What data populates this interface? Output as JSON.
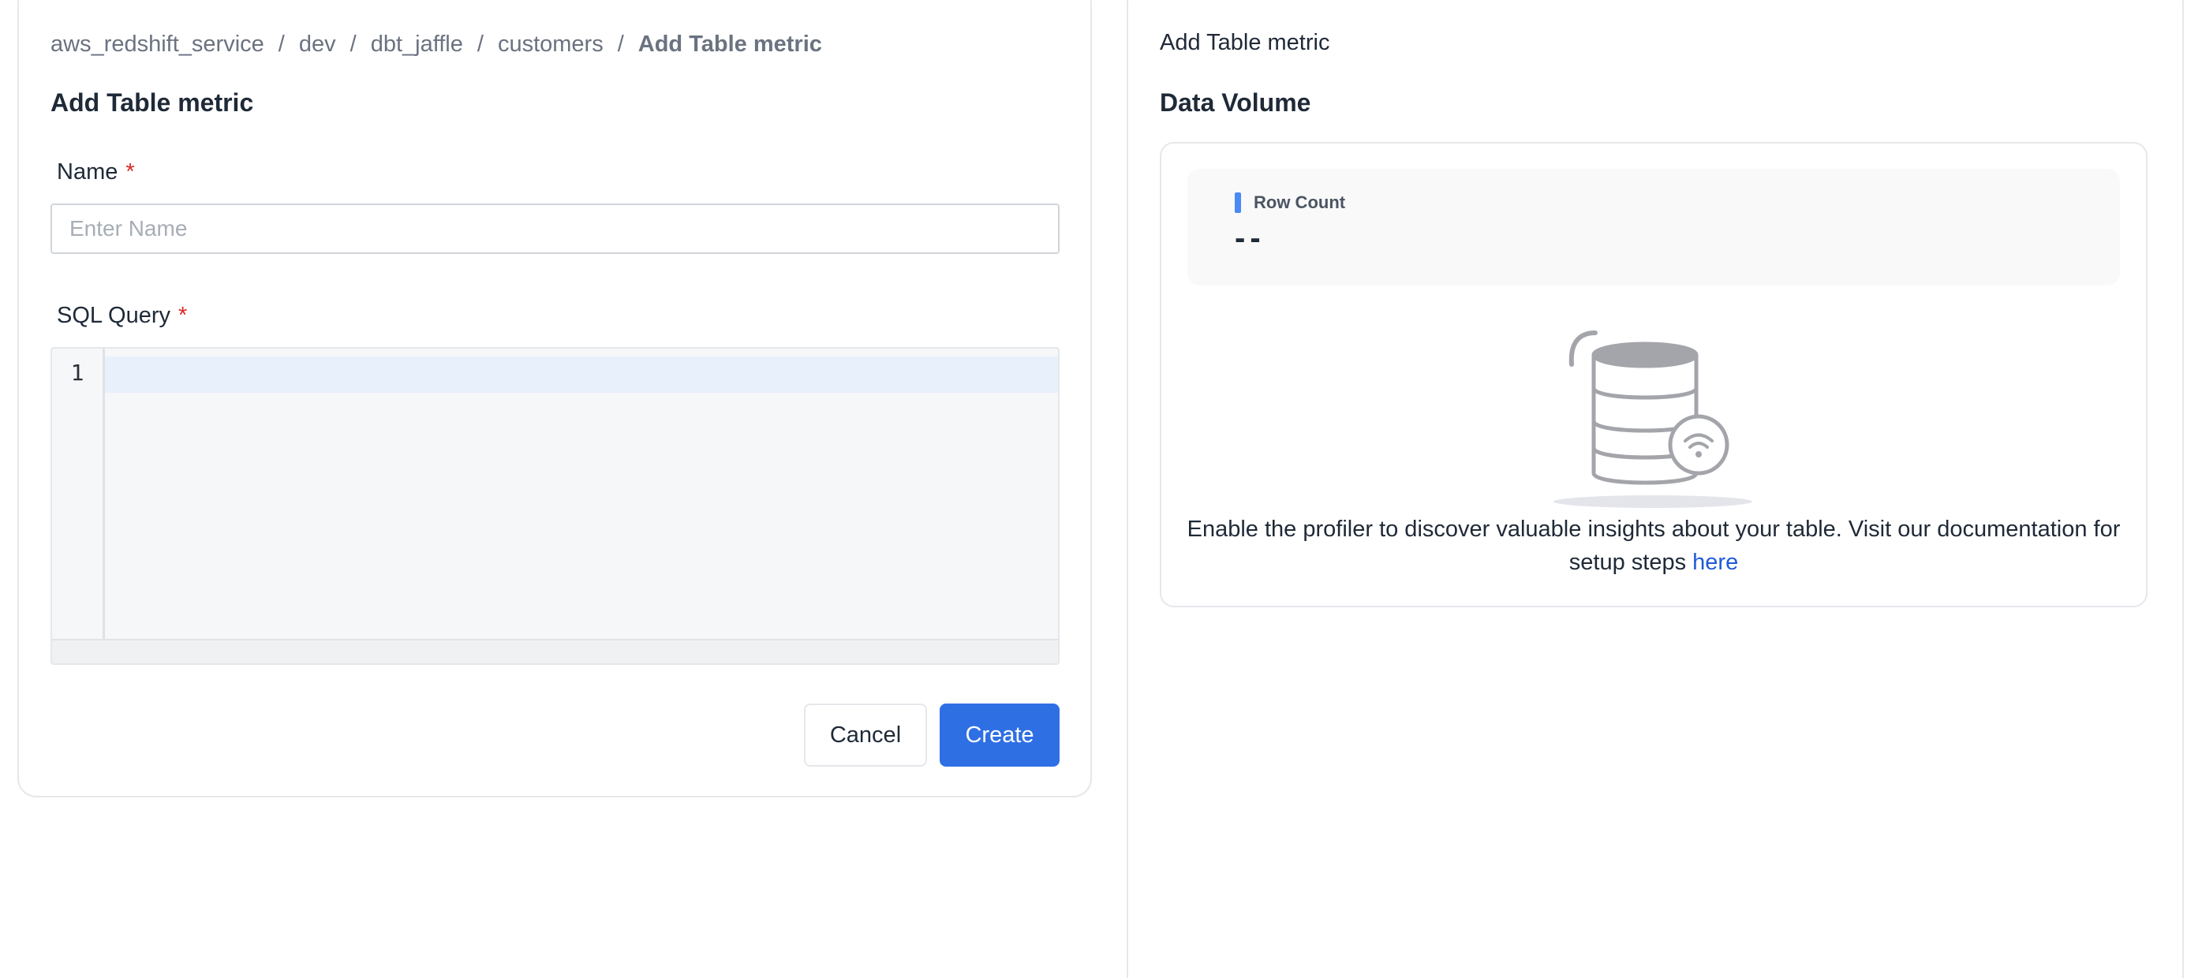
{
  "breadcrumb": {
    "items": [
      "aws_redshift_service",
      "dev",
      "dbt_jaffle",
      "customers",
      "Add Table metric"
    ],
    "separator": "/"
  },
  "form": {
    "title": "Add Table metric",
    "name_label": "Name",
    "name_placeholder": "Enter Name",
    "name_value": "",
    "required_mark": "*",
    "sql_label": "SQL Query",
    "sql_line_number": "1",
    "cancel_label": "Cancel",
    "create_label": "Create"
  },
  "preview": {
    "panel_title": "Add Table metric",
    "section_title": "Data Volume",
    "row_count_label": "Row Count",
    "row_count_value": "--",
    "empty_message": "Enable the profiler to discover valuable insights about your table. Visit our documentation for setup steps",
    "doc_link_label": "here"
  },
  "colors": {
    "primary": "#2f6fe4",
    "required": "#dc2626",
    "link": "#1e5bd8",
    "row_count_marker": "#4a8af4"
  },
  "icons": {
    "empty_state": "database-no-connection-icon"
  }
}
